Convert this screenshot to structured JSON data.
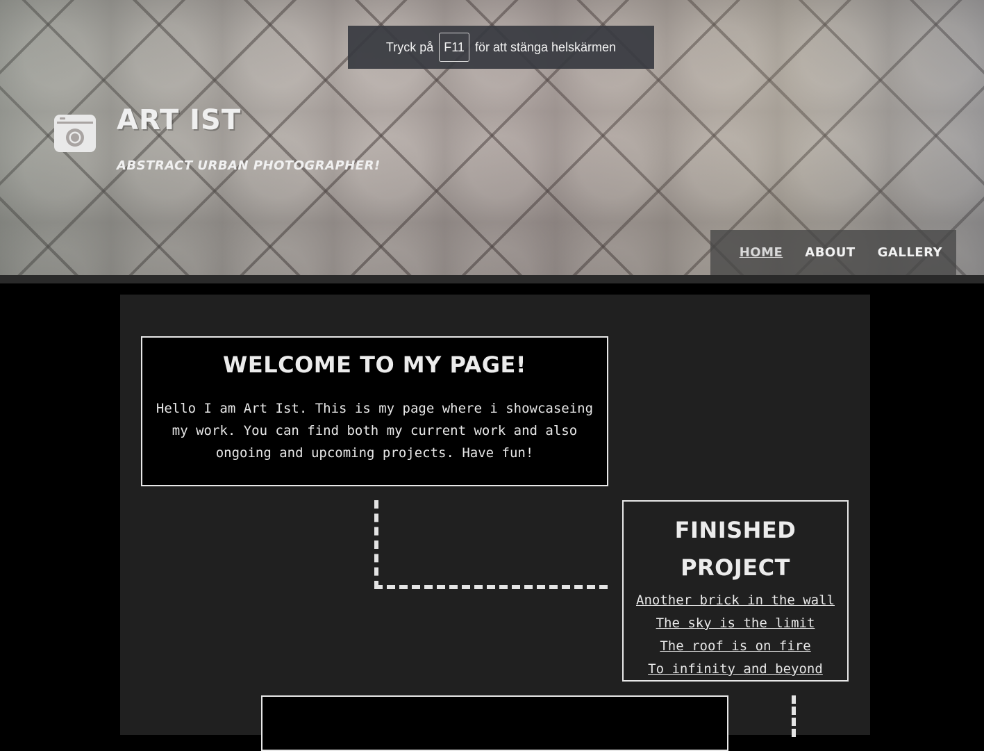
{
  "fullscreen_notice": {
    "before": "Tryck på",
    "key": "F11",
    "after": "för att stänga helskärmen"
  },
  "header": {
    "logo_icon": "camera-icon",
    "title": "ART IST",
    "subtitle": "ABSTRACT URBAN PHOTOGRAPHER!",
    "nav": [
      {
        "label": "HOME",
        "active": true
      },
      {
        "label": "ABOUT",
        "active": false
      },
      {
        "label": "GALLERY",
        "active": false
      }
    ]
  },
  "welcome": {
    "heading": "WELCOME TO MY PAGE!",
    "text": "Hello I am Art Ist. This is my page where i showcaseing my work. You can find both my current work and also ongoing and upcoming projects. Have fun!"
  },
  "finished": {
    "heading_line1": "FINISHED",
    "heading_line2": "PROJECT",
    "links": [
      "Another brick in the wall",
      "The sky is the limit",
      "The roof is on fire",
      "To infinity and beyond"
    ]
  },
  "colors": {
    "page_bg": "#000000",
    "main_bg": "#202020",
    "box_border": "#e8e8e8",
    "text": "#e6e6e6",
    "nav_bg": "#464646"
  }
}
